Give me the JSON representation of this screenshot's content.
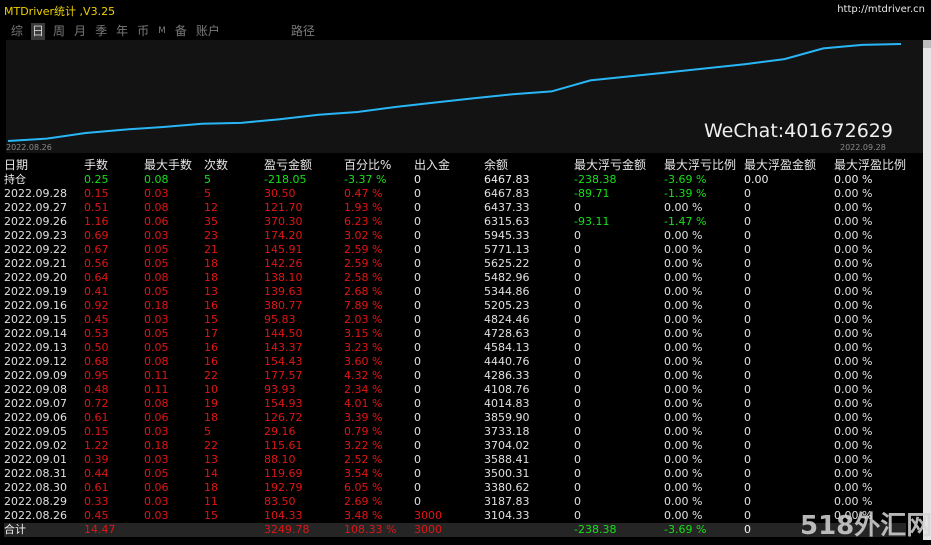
{
  "app": {
    "title": "MTDriver统计 ,V3.25",
    "url": "http://mtdriver.cn"
  },
  "tabs": [
    {
      "label": "综"
    },
    {
      "label": "日"
    },
    {
      "label": "周"
    },
    {
      "label": "月"
    },
    {
      "label": "季"
    },
    {
      "label": "年"
    },
    {
      "label": "币"
    },
    {
      "label": "M"
    },
    {
      "label": "备"
    },
    {
      "label": "账户"
    },
    {
      "label": "路径"
    }
  ],
  "active_tab": "日",
  "chart": {
    "date_start": "2022.08.26",
    "date_end": "2022.09.28",
    "line_color": "#29b6f6",
    "watermark_text": "WeChat:401672629"
  },
  "chart_data": {
    "type": "line",
    "x": [
      "2022.08.26",
      "2022.08.29",
      "2022.08.30",
      "2022.08.31",
      "2022.09.01",
      "2022.09.02",
      "2022.09.05",
      "2022.09.06",
      "2022.09.07",
      "2022.09.08",
      "2022.09.09",
      "2022.09.12",
      "2022.09.13",
      "2022.09.14",
      "2022.09.15",
      "2022.09.16",
      "2022.09.19",
      "2022.09.20",
      "2022.09.21",
      "2022.09.22",
      "2022.09.23",
      "2022.09.26",
      "2022.09.27",
      "2022.09.28"
    ],
    "values": [
      3104.33,
      3187.83,
      3380.62,
      3500.31,
      3588.41,
      3704.02,
      3733.18,
      3859.9,
      4014.83,
      4108.76,
      4286.33,
      4440.76,
      4584.13,
      4728.63,
      4824.46,
      5205.23,
      5344.86,
      5482.96,
      5625.22,
      5771.13,
      5945.33,
      6315.63,
      6437.33,
      6467.83
    ]
  },
  "table": {
    "headers": [
      "日期",
      "手数",
      "最大手数",
      "次数",
      "盈亏金额",
      "百分比%",
      "出入金",
      "余额",
      "最大浮亏金额",
      "最大浮亏比例",
      "最大浮盈金额",
      "最大浮盈比例"
    ],
    "position": [
      "持仓",
      "0.25",
      "0.08",
      "5",
      "-218.05",
      "-3.37 %",
      "0",
      "6467.83",
      "-238.38",
      "-3.69 %",
      "0.00",
      "0.00 %"
    ],
    "rows": [
      [
        "2022.09.28",
        "0.15",
        "0.03",
        "5",
        "30.50",
        "0.47 %",
        "0",
        "6467.83",
        "-89.71",
        "-1.39 %",
        "0",
        "0.00 %"
      ],
      [
        "2022.09.27",
        "0.51",
        "0.08",
        "12",
        "121.70",
        "1.93 %",
        "0",
        "6437.33",
        "0",
        "0.00 %",
        "0",
        "0.00 %"
      ],
      [
        "2022.09.26",
        "1.16",
        "0.06",
        "35",
        "370.30",
        "6.23 %",
        "0",
        "6315.63",
        "-93.11",
        "-1.47 %",
        "0",
        "0.00 %"
      ],
      [
        "2022.09.23",
        "0.69",
        "0.03",
        "23",
        "174.20",
        "3.02 %",
        "0",
        "5945.33",
        "0",
        "0.00 %",
        "0",
        "0.00 %"
      ],
      [
        "2022.09.22",
        "0.67",
        "0.05",
        "21",
        "145.91",
        "2.59 %",
        "0",
        "5771.13",
        "0",
        "0.00 %",
        "0",
        "0.00 %"
      ],
      [
        "2022.09.21",
        "0.56",
        "0.05",
        "18",
        "142.26",
        "2.59 %",
        "0",
        "5625.22",
        "0",
        "0.00 %",
        "0",
        "0.00 %"
      ],
      [
        "2022.09.20",
        "0.64",
        "0.08",
        "18",
        "138.10",
        "2.58 %",
        "0",
        "5482.96",
        "0",
        "0.00 %",
        "0",
        "0.00 %"
      ],
      [
        "2022.09.19",
        "0.41",
        "0.05",
        "13",
        "139.63",
        "2.68 %",
        "0",
        "5344.86",
        "0",
        "0.00 %",
        "0",
        "0.00 %"
      ],
      [
        "2022.09.16",
        "0.92",
        "0.18",
        "16",
        "380.77",
        "7.89 %",
        "0",
        "5205.23",
        "0",
        "0.00 %",
        "0",
        "0.00 %"
      ],
      [
        "2022.09.15",
        "0.45",
        "0.03",
        "15",
        "95.83",
        "2.03 %",
        "0",
        "4824.46",
        "0",
        "0.00 %",
        "0",
        "0.00 %"
      ],
      [
        "2022.09.14",
        "0.53",
        "0.05",
        "17",
        "144.50",
        "3.15 %",
        "0",
        "4728.63",
        "0",
        "0.00 %",
        "0",
        "0.00 %"
      ],
      [
        "2022.09.13",
        "0.50",
        "0.05",
        "16",
        "143.37",
        "3.23 %",
        "0",
        "4584.13",
        "0",
        "0.00 %",
        "0",
        "0.00 %"
      ],
      [
        "2022.09.12",
        "0.68",
        "0.08",
        "16",
        "154.43",
        "3.60 %",
        "0",
        "4440.76",
        "0",
        "0.00 %",
        "0",
        "0.00 %"
      ],
      [
        "2022.09.09",
        "0.95",
        "0.11",
        "22",
        "177.57",
        "4.32 %",
        "0",
        "4286.33",
        "0",
        "0.00 %",
        "0",
        "0.00 %"
      ],
      [
        "2022.09.08",
        "0.48",
        "0.11",
        "10",
        "93.93",
        "2.34 %",
        "0",
        "4108.76",
        "0",
        "0.00 %",
        "0",
        "0.00 %"
      ],
      [
        "2022.09.07",
        "0.72",
        "0.08",
        "19",
        "154.93",
        "4.01 %",
        "0",
        "4014.83",
        "0",
        "0.00 %",
        "0",
        "0.00 %"
      ],
      [
        "2022.09.06",
        "0.61",
        "0.06",
        "18",
        "126.72",
        "3.39 %",
        "0",
        "3859.90",
        "0",
        "0.00 %",
        "0",
        "0.00 %"
      ],
      [
        "2022.09.05",
        "0.15",
        "0.03",
        "5",
        "29.16",
        "0.79 %",
        "0",
        "3733.18",
        "0",
        "0.00 %",
        "0",
        "0.00 %"
      ],
      [
        "2022.09.02",
        "1.22",
        "0.18",
        "22",
        "115.61",
        "3.22 %",
        "0",
        "3704.02",
        "0",
        "0.00 %",
        "0",
        "0.00 %"
      ],
      [
        "2022.09.01",
        "0.39",
        "0.03",
        "13",
        "88.10",
        "2.52 %",
        "0",
        "3588.41",
        "0",
        "0.00 %",
        "0",
        "0.00 %"
      ],
      [
        "2022.08.31",
        "0.44",
        "0.05",
        "14",
        "119.69",
        "3.54 %",
        "0",
        "3500.31",
        "0",
        "0.00 %",
        "0",
        "0.00 %"
      ],
      [
        "2022.08.30",
        "0.61",
        "0.06",
        "18",
        "192.79",
        "6.05 %",
        "0",
        "3380.62",
        "0",
        "0.00 %",
        "0",
        "0.00 %"
      ],
      [
        "2022.08.29",
        "0.33",
        "0.03",
        "11",
        "83.50",
        "2.69 %",
        "0",
        "3187.83",
        "0",
        "0.00 %",
        "0",
        "0.00 %"
      ],
      [
        "2022.08.26",
        "0.45",
        "0.03",
        "15",
        "104.33",
        "3.48 %",
        "3000",
        "3104.33",
        "0",
        "0.00 %",
        "0",
        "0.00 %"
      ]
    ],
    "total": [
      "合计",
      "14.47",
      "",
      "",
      "3249.78",
      "108.33 %",
      "3000",
      "",
      "-238.38",
      "-3.69 %",
      "0",
      ""
    ]
  },
  "colors": {
    "profit": "#e01515",
    "loss": "#16e016",
    "title": "#f0d000"
  },
  "watermark": "518外汇网"
}
